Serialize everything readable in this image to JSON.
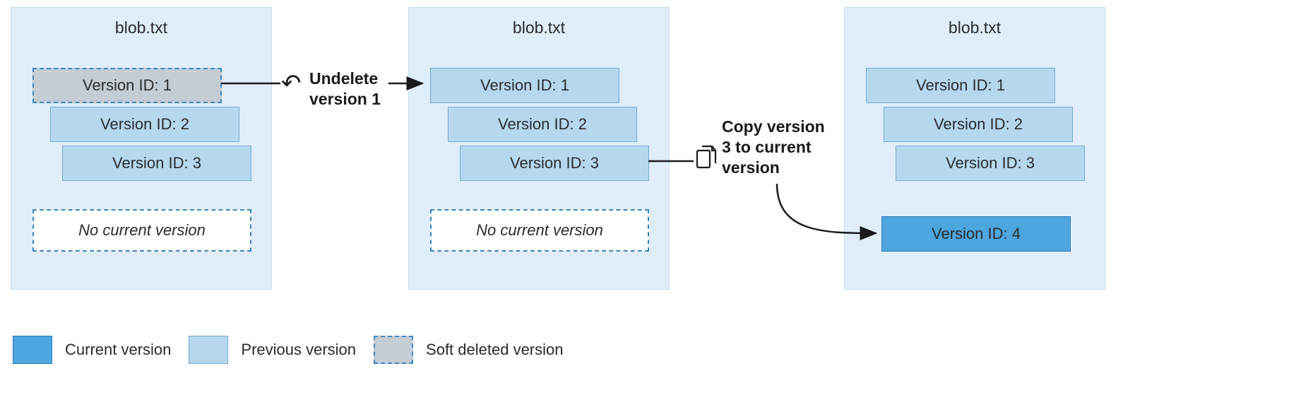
{
  "panels": {
    "a": {
      "title": "blob.txt",
      "v1": "Version ID: 1",
      "v2": "Version ID: 2",
      "v3": "Version ID: 3",
      "no_current": "No current version"
    },
    "b": {
      "title": "blob.txt",
      "v1": "Version ID: 1",
      "v2": "Version ID: 2",
      "v3": "Version ID: 3",
      "no_current": "No current version"
    },
    "c": {
      "title": "blob.txt",
      "v1": "Version ID: 1",
      "v2": "Version ID: 2",
      "v3": "Version ID: 3",
      "v4": "Version ID: 4"
    }
  },
  "actions": {
    "undelete": "Undelete\nversion 1",
    "copy": "Copy version\n3 to current\nversion"
  },
  "legend": {
    "current": "Current version",
    "previous": "Previous version",
    "softdel": "Soft deleted version"
  }
}
